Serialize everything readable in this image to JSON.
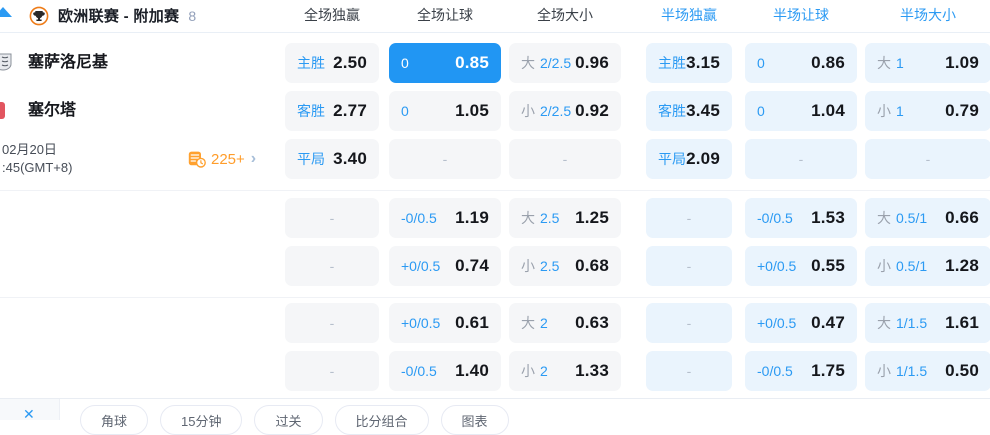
{
  "header": {
    "league_title": "欧洲联赛 - 附加赛",
    "match_count": "8",
    "columns": [
      "全场独赢",
      "全场让球",
      "全场大小",
      "半场独赢",
      "半场让球",
      "半场大小"
    ]
  },
  "match": {
    "home_team": "塞萨洛尼基",
    "away_team": "塞尔塔",
    "date": "02月20日",
    "time": ":45(GMT+8)",
    "extra_markets": "225+"
  },
  "icons": {
    "league": "trophy-icon",
    "markets": "coin-clock-icon",
    "chevron_right": "›",
    "collapse_top": "triangle-up-icon",
    "footer_collapse": "✕"
  },
  "colors": {
    "highlight_blue": "#2196f3",
    "label_blue": "#2b9af3",
    "orange": "#ff9d2b",
    "fulltime_cell_bg": "#f5f6f8",
    "halftime_cell_bg": "#eaf4fd"
  },
  "odds_rows": [
    {
      "cells": [
        {
          "lab": "主胜",
          "val": "2.50"
        },
        {
          "lab": "0",
          "val": "0.85",
          "hl": true
        },
        {
          "pre": "大",
          "lab": "2/2.5",
          "val": "0.96"
        },
        {
          "lab": "主胜",
          "val": "3.15"
        },
        {
          "lab": "0",
          "val": "0.86"
        },
        {
          "pre": "大",
          "lab": "1",
          "val": "1.09"
        }
      ]
    },
    {
      "cells": [
        {
          "lab": "客胜",
          "val": "2.77"
        },
        {
          "lab": "0",
          "val": "1.05"
        },
        {
          "pre": "小",
          "lab": "2/2.5",
          "val": "0.92"
        },
        {
          "lab": "客胜",
          "val": "3.45"
        },
        {
          "lab": "0",
          "val": "1.04"
        },
        {
          "pre": "小",
          "lab": "1",
          "val": "0.79"
        }
      ]
    },
    {
      "cells": [
        {
          "lab": "平局",
          "val": "3.40"
        },
        {
          "dash": "-"
        },
        {
          "dash": "-"
        },
        {
          "lab": "平局",
          "val": "2.09"
        },
        {
          "dash": "-"
        },
        {
          "dash": "-"
        }
      ]
    },
    {
      "cells": [
        {
          "dash": "-"
        },
        {
          "lab": "-0/0.5",
          "val": "1.19"
        },
        {
          "pre": "大",
          "lab": "2.5",
          "val": "1.25"
        },
        {
          "dash": "-"
        },
        {
          "lab": "-0/0.5",
          "val": "1.53"
        },
        {
          "pre": "大",
          "lab": "0.5/1",
          "val": "0.66"
        }
      ]
    },
    {
      "cells": [
        {
          "dash": "-"
        },
        {
          "lab": "+0/0.5",
          "val": "0.74"
        },
        {
          "pre": "小",
          "lab": "2.5",
          "val": "0.68"
        },
        {
          "dash": "-"
        },
        {
          "lab": "+0/0.5",
          "val": "0.55"
        },
        {
          "pre": "小",
          "lab": "0.5/1",
          "val": "1.28"
        }
      ]
    },
    {
      "cells": [
        {
          "dash": "-"
        },
        {
          "lab": "+0/0.5",
          "val": "0.61"
        },
        {
          "pre": "大",
          "lab": "2",
          "val": "0.63"
        },
        {
          "dash": "-"
        },
        {
          "lab": "+0/0.5",
          "val": "0.47"
        },
        {
          "pre": "大",
          "lab": "1/1.5",
          "val": "1.61"
        }
      ]
    },
    {
      "cells": [
        {
          "dash": "-"
        },
        {
          "lab": "-0/0.5",
          "val": "1.40"
        },
        {
          "pre": "小",
          "lab": "2",
          "val": "1.33"
        },
        {
          "dash": "-"
        },
        {
          "lab": "-0/0.5",
          "val": "1.75"
        },
        {
          "pre": "小",
          "lab": "1/1.5",
          "val": "0.50"
        }
      ]
    }
  ],
  "footer": {
    "tabs": [
      "角球",
      "15分钟",
      "过关",
      "比分组合",
      "图表"
    ]
  }
}
